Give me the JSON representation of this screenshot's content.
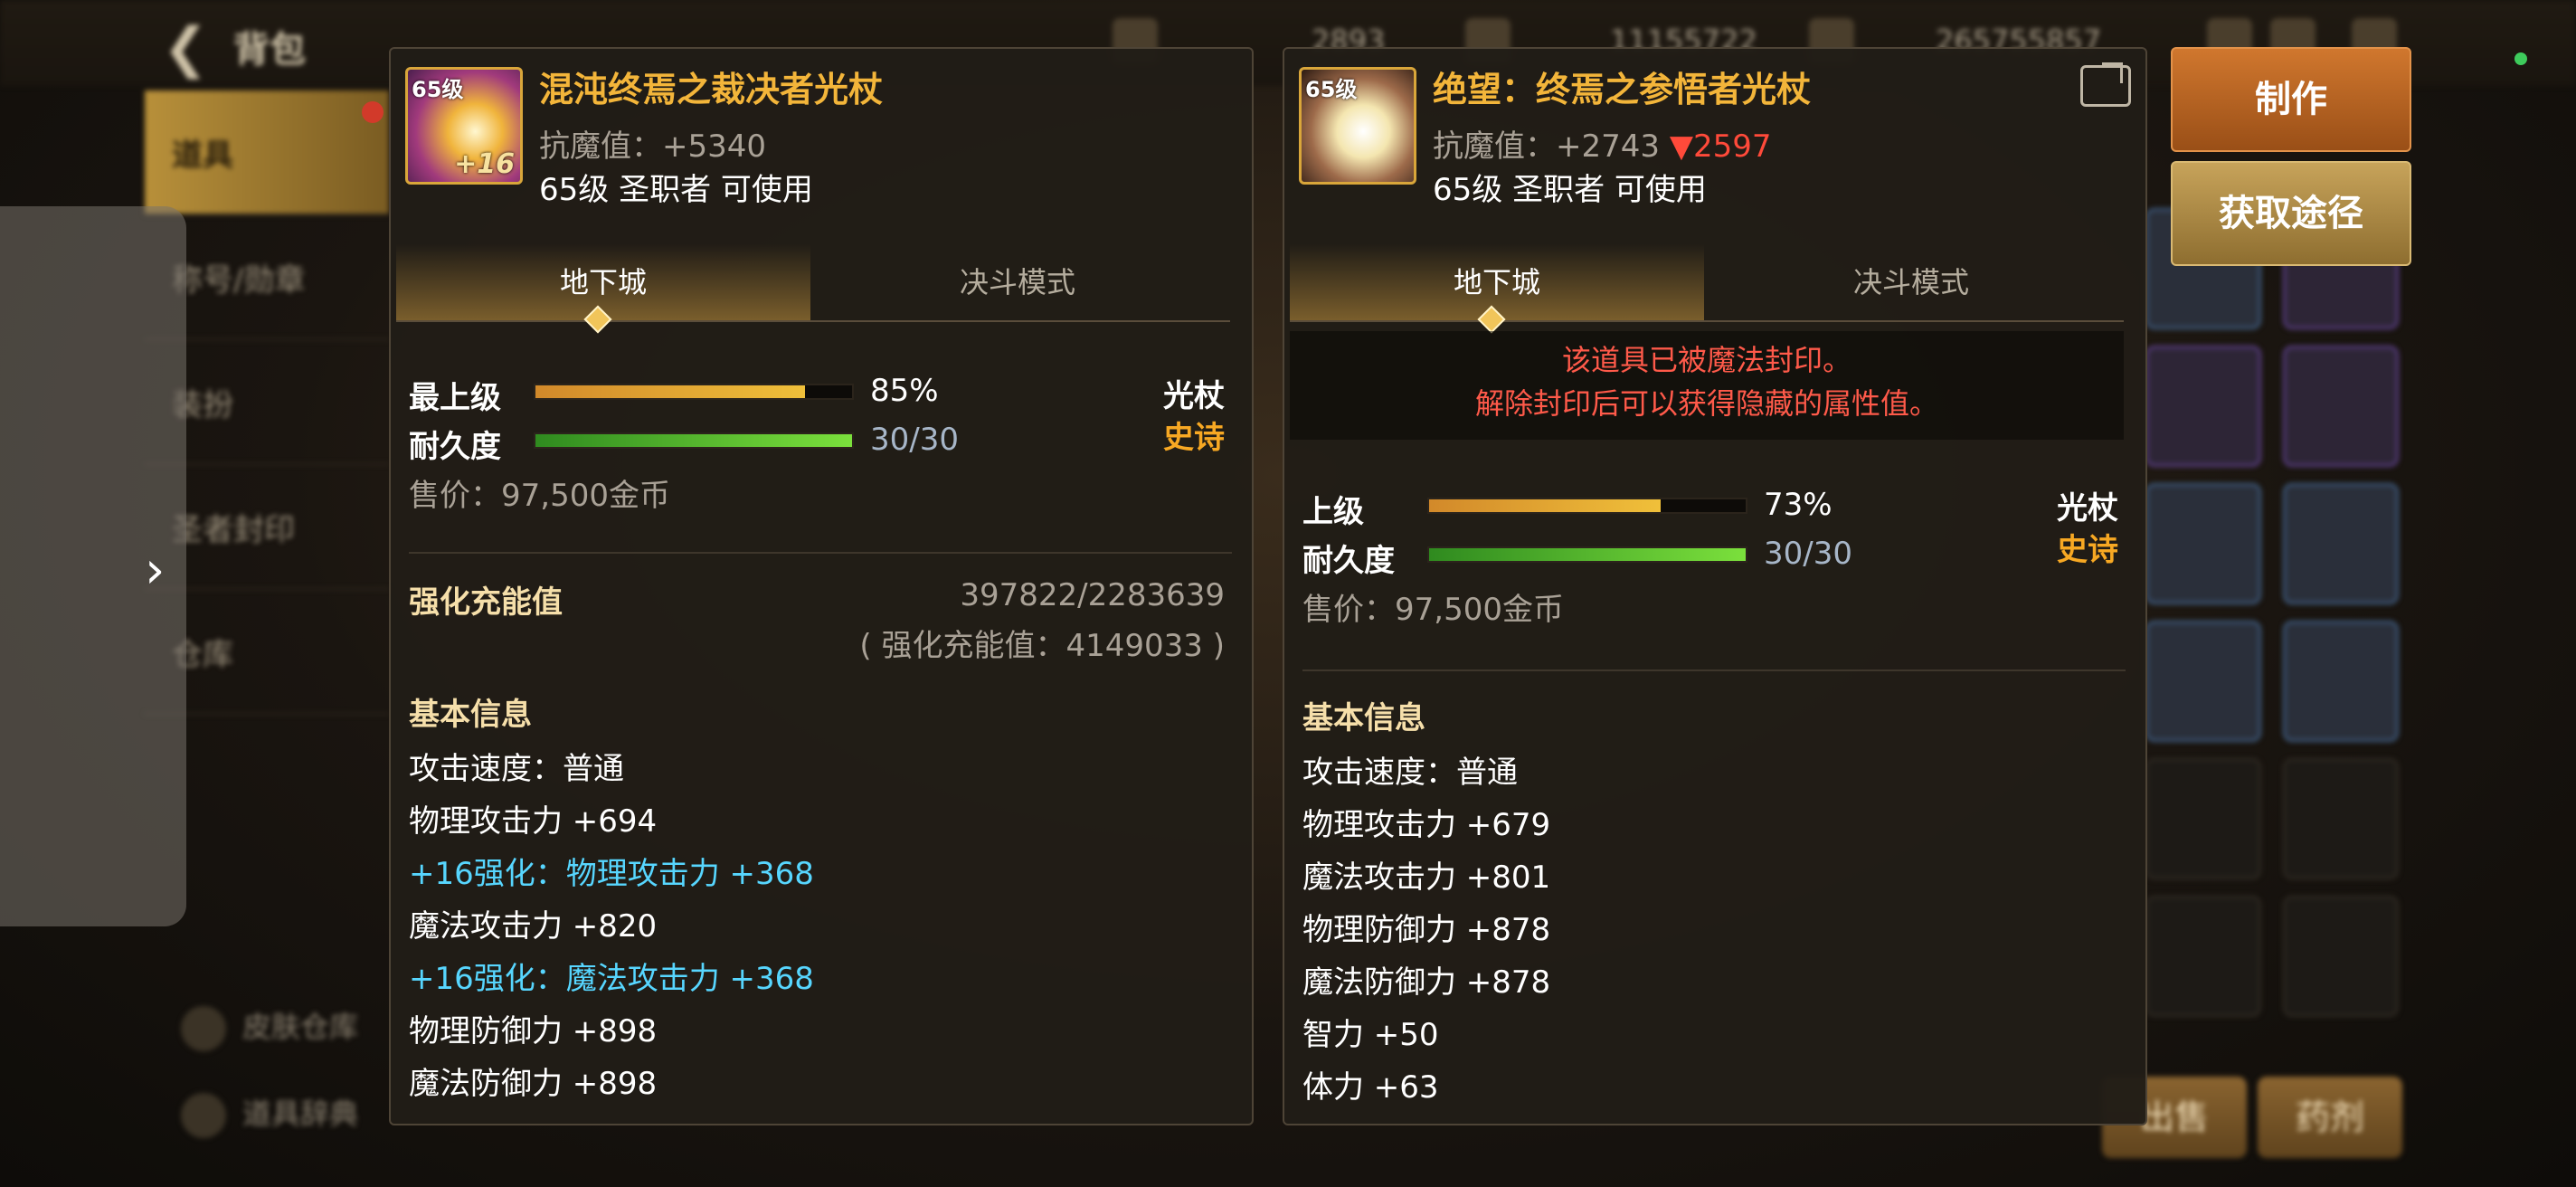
{
  "background": {
    "title": "背包",
    "menu": [
      "道具",
      "称号/勋章",
      "装扮",
      "圣者封印",
      "仓库"
    ],
    "currencies": [
      "2893",
      "11155722",
      "265755857"
    ],
    "bottom_links": [
      "皮肤仓库",
      "道具辞典"
    ],
    "bottom_buttons": [
      "出售",
      "药剂"
    ]
  },
  "actions": {
    "make": "制作",
    "get_route": "获取途径"
  },
  "left_item": {
    "name": "混沌终焉之裁决者光杖",
    "icon_level": "65级",
    "icon_plus": "+16",
    "resist": "抗魔值：+5340",
    "requirement": "65级 圣职者 可使用",
    "tabs": [
      "地下城",
      "决斗模式"
    ],
    "grade_label": "最上级",
    "grade_pct": "85%",
    "grade_value": 85,
    "durability_label": "耐久度",
    "durability": "30/30",
    "durability_value": 100,
    "weapon_type": "光杖",
    "rarity": "史诗",
    "price": "售价：97,500金币",
    "enhance_label": "强化充能值",
    "enhance_value": "397822/2283639",
    "enhance_total": "( 强化充能值：4149033 )",
    "basic_info": "基本信息",
    "attributes": [
      {
        "text": "攻击速度：普通",
        "highlight": false
      },
      {
        "text": "物理攻击力 +694",
        "highlight": false
      },
      {
        "text": "+16强化：物理攻击力 +368",
        "highlight": true
      },
      {
        "text": "魔法攻击力 +820",
        "highlight": false
      },
      {
        "text": "+16强化：魔法攻击力 +368",
        "highlight": true
      },
      {
        "text": "物理防御力 +898",
        "highlight": false
      },
      {
        "text": "魔法防御力 +898",
        "highlight": false
      }
    ]
  },
  "right_item": {
    "name": "绝望：终焉之参悟者光杖",
    "icon_level": "65级",
    "resist_prefix": "抗魔值：+2743 ",
    "resist_diff": "▼2597",
    "requirement": "65级 圣职者 可使用",
    "tabs": [
      "地下城",
      "决斗模式"
    ],
    "seal_line1": "该道具已被魔法封印。",
    "seal_line2": "解除封印后可以获得隐藏的属性值。",
    "grade_label": "上级",
    "grade_pct": "73%",
    "grade_value": 73,
    "durability_label": "耐久度",
    "durability": "30/30",
    "durability_value": 100,
    "weapon_type": "光杖",
    "rarity": "史诗",
    "price": "售价：97,500金币",
    "basic_info": "基本信息",
    "attributes": [
      {
        "text": "攻击速度：普通"
      },
      {
        "text": "物理攻击力 +679"
      },
      {
        "text": "魔法攻击力 +801"
      },
      {
        "text": "物理防御力 +878"
      },
      {
        "text": "魔法防御力 +878"
      },
      {
        "text": "智力 +50"
      },
      {
        "text": "体力 +63"
      }
    ]
  },
  "colors": {
    "item_name": "#f3b53a",
    "rarity": "#f7a823",
    "enhance_text": "#57d6ff",
    "seal_notice": "#ff5a4a",
    "stat_down": "#ff4a3a"
  }
}
